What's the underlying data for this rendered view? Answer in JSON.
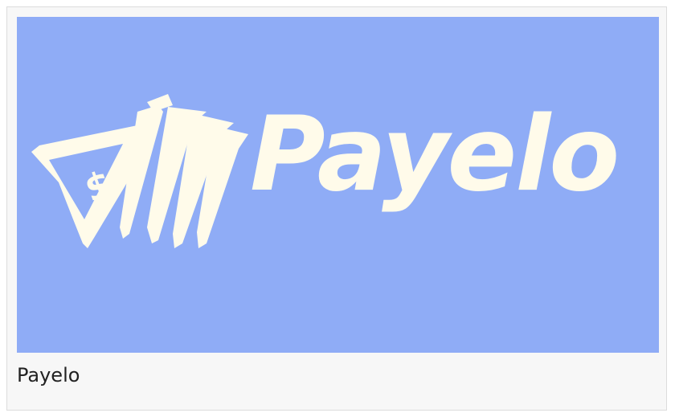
{
  "logo": {
    "wordmark": "Payelo",
    "icon": "money-bills-dollar-icon",
    "background_color": "#8facf6",
    "foreground_color": "#fffbea"
  },
  "caption": "Payelo"
}
